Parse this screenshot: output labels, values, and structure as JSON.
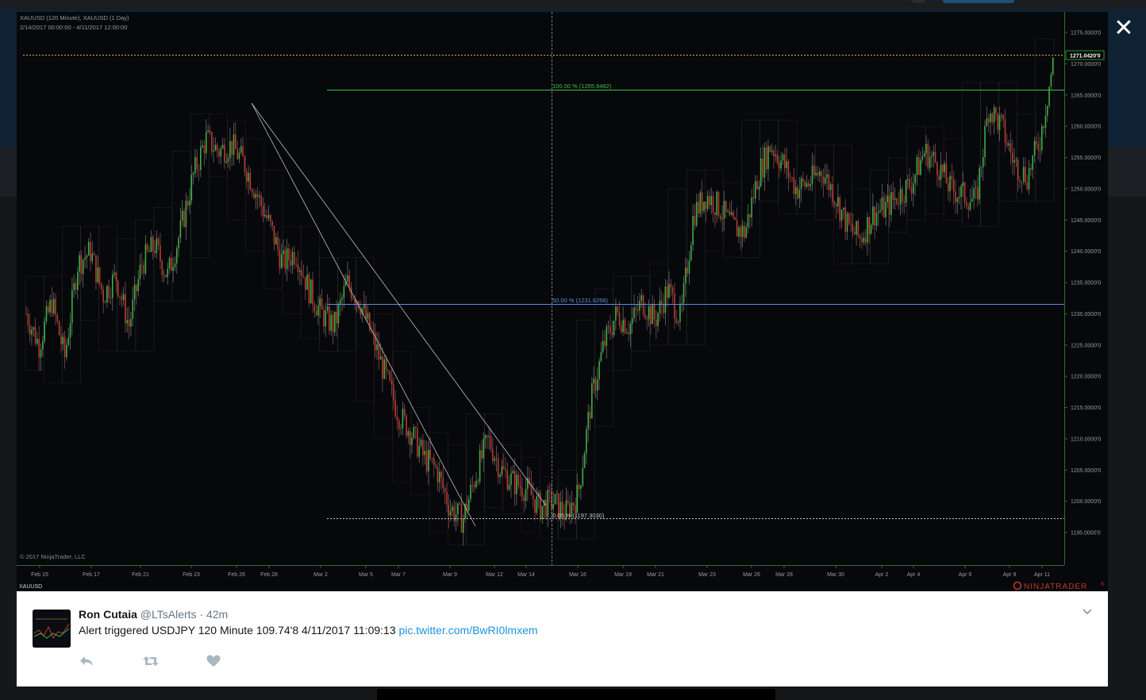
{
  "close": {
    "glyph": "✕"
  },
  "chart": {
    "header_line1": "XAUUSD (120 Minute), XAUUSD (1 Day)",
    "header_line2": "2/14/2017 00:00:00 - 4/11/2017 12:00:00",
    "copyright": "© 2017 NinjaTrader, LLC",
    "instrument": "XAUUSD",
    "brand": "NINJATRADER",
    "brand_mark": "®",
    "current_price": "1271.0420'0",
    "fib_100": "100.00 % (1265.9482)",
    "fib_50": "50.00 % (1231.6256)",
    "fib_0": "0.00 % (1197.3030)"
  },
  "chart_data": {
    "type": "candlestick",
    "instrument": "XAUUSD",
    "timeframes": [
      "120 Minute",
      "1 Day"
    ],
    "range": "2/14/2017 00:00:00 - 4/11/2017 12:00:00",
    "ylim": [
      1190,
      1277
    ],
    "yticks": [
      "1275.0000'0",
      "1270.0000'0",
      "1265.0000'0",
      "1260.0000'0",
      "1255.0000'0",
      "1250.0000'0",
      "1245.0000'0",
      "1240.0000'0",
      "1235.0000'0",
      "1230.0000'0",
      "1225.0000'0",
      "1220.0000'0",
      "1215.0000'0",
      "1210.0000'0",
      "1205.0000'0",
      "1200.0000'0",
      "1195.0000'0"
    ],
    "xticks": [
      "Feb 15",
      "Feb 17",
      "Feb 21",
      "Feb 23",
      "Feb 26",
      "Feb 28",
      "Mar 2",
      "Mar 5",
      "Mar 7",
      "Mar 9",
      "Mar 12",
      "Mar 14",
      "Mar 16",
      "Mar 19",
      "Mar 21",
      "Mar 23",
      "Mar 26",
      "Mar 28",
      "Mar 30",
      "Apr 2",
      "Apr 4",
      "Apr 6",
      "Apr 9",
      "Apr 11"
    ],
    "last_price": 1271.042,
    "fibonacci": [
      {
        "level": "100.00 %",
        "price": 1265.9482
      },
      {
        "level": "50.00 %",
        "price": 1231.6256
      },
      {
        "level": "0.00 %",
        "price": 1197.303
      }
    ],
    "close_path": [
      1230,
      1225,
      1232,
      1223,
      1238,
      1240,
      1233,
      1236,
      1228,
      1238,
      1241,
      1236,
      1243,
      1252,
      1258,
      1256,
      1257,
      1254,
      1249,
      1244,
      1238,
      1240,
      1234,
      1230,
      1228,
      1235,
      1232,
      1226,
      1220,
      1214,
      1211,
      1207,
      1205,
      1199,
      1197,
      1204,
      1210,
      1205,
      1203,
      1202,
      1199,
      1200,
      1198,
      1201,
      1216,
      1225,
      1230,
      1228,
      1232,
      1229,
      1234,
      1229,
      1246,
      1249,
      1247,
      1244,
      1243,
      1252,
      1257,
      1254,
      1250,
      1251,
      1253,
      1249,
      1244,
      1242,
      1246,
      1247,
      1249,
      1251,
      1256,
      1254,
      1250,
      1249,
      1248,
      1263,
      1260,
      1254,
      1252,
      1258,
      1270
    ]
  },
  "tweet": {
    "name": "Ron Cutaia",
    "handle": "@LTsAlerts",
    "dot": "·",
    "time": "42m",
    "text": "Alert triggered USDJPY 120 Minute 109.74'8 4/11/2017 11:09:13",
    "link": "pic.twitter.com/BwRI0lmxem"
  },
  "colors": {
    "chart_bg": "#07080c",
    "fib_100": "#3dc23d",
    "fib_50": "#5b8fe0",
    "fib_0": "#c8c8c8",
    "last_price_line": "#d7a84a",
    "link": "#1b95e0",
    "up_candle": "#3cb043",
    "down_candle": "#c0392b"
  }
}
